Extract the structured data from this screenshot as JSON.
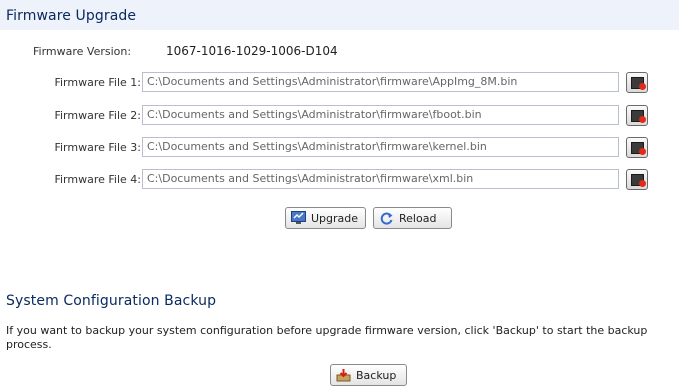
{
  "firmware_upgrade": {
    "title": "Firmware Upgrade",
    "version_label": "Firmware Version:",
    "version_value": "1067-1016-1029-1006-D104",
    "files": [
      {
        "label": "Firmware File 1:",
        "value": "C:\\Documents and Settings\\Administrator\\firmware\\AppImg_8M.bin"
      },
      {
        "label": "Firmware File 2:",
        "value": "C:\\Documents and Settings\\Administrator\\firmware\\fboot.bin"
      },
      {
        "label": "Firmware File 3:",
        "value": "C:\\Documents and Settings\\Administrator\\firmware\\kernel.bin"
      },
      {
        "label": "Firmware File 4:",
        "value": "C:\\Documents and Settings\\Administrator\\firmware\\xml.bin"
      }
    ],
    "upgrade_label": "Upgrade",
    "reload_label": "Reload"
  },
  "config_backup": {
    "title": "System Configuration Backup",
    "description_line1": "If you want to backup your system configuration before upgrade firmware version, click 'Backup' to start the backup",
    "description_line2": "process.",
    "backup_label": "Backup"
  },
  "icons": {
    "browse": "browse-folder-icon",
    "upgrade": "upgrade-icon",
    "reload": "reload-icon",
    "backup": "backup-icon"
  },
  "colors": {
    "title_bar": "#eef2fb",
    "title_text": "#0a2a60",
    "input_border": "#b8c0cc",
    "browse_dot": "#e02a1a"
  }
}
